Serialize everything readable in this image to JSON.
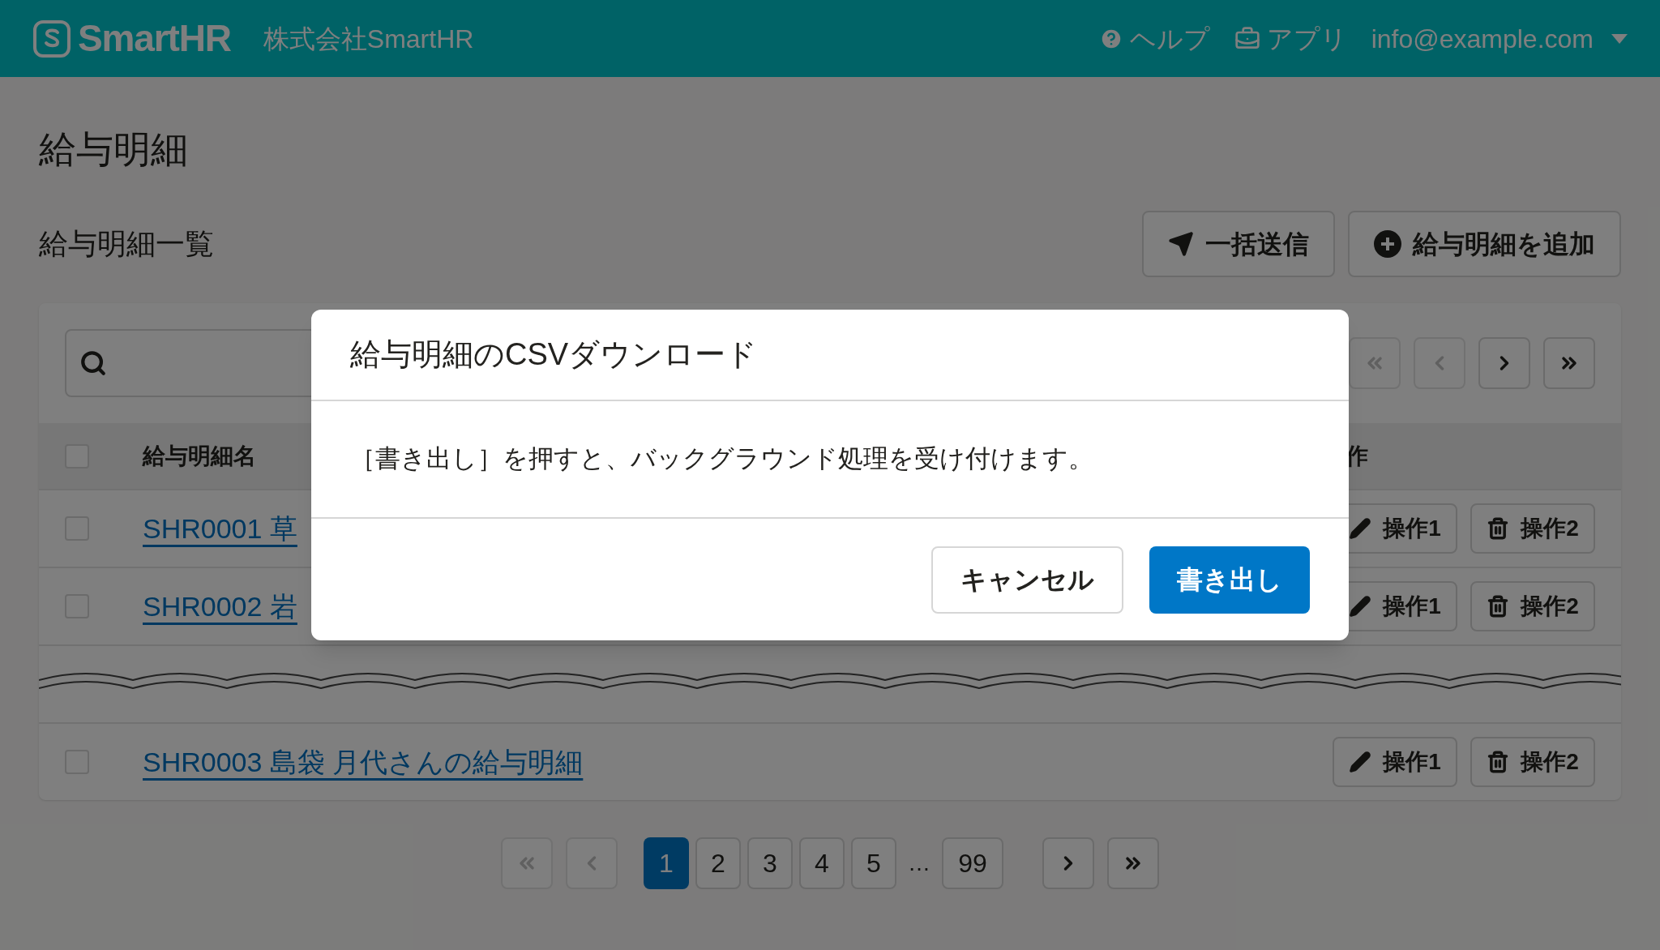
{
  "header": {
    "logo": "SmartHR",
    "company": "株式会社SmartHR",
    "nav": [
      {
        "kind": "help",
        "label": "ヘルプ"
      },
      {
        "kind": "apps",
        "label": "アプリ"
      }
    ],
    "user": "info@example.com"
  },
  "page_title": "給与明細",
  "section_title": "給与明細一覧",
  "actions": [
    {
      "kind": "send",
      "label": "一括送信"
    },
    {
      "kind": "add",
      "label": "給与明細を追加"
    }
  ],
  "table": {
    "top_pager": [
      {
        "kind": "first",
        "disabled": true
      },
      {
        "kind": "prev",
        "disabled": true
      },
      {
        "kind": "next",
        "disabled": false
      },
      {
        "kind": "last",
        "disabled": false
      }
    ],
    "columns": [
      "給与明細名",
      "作"
    ],
    "header_checked": false,
    "rows": [
      {
        "kind": "row",
        "name": "SHR0001 草",
        "checked": false,
        "actions": [
          "操作1",
          "操作2"
        ]
      },
      {
        "kind": "row",
        "name": "SHR0002 岩",
        "checked": false,
        "actions": [
          "操作1",
          "操作2"
        ]
      },
      {
        "kind": "break"
      },
      {
        "kind": "row",
        "name": "SHR0003 島袋 月代さんの給与明細",
        "checked": false,
        "actions": [
          "操作1",
          "操作2"
        ]
      }
    ]
  },
  "pagination": {
    "first_disabled": true,
    "prev_disabled": true,
    "pages": [
      {
        "label": "1",
        "selected": true
      },
      {
        "label": "2",
        "selected": false
      },
      {
        "label": "3",
        "selected": false
      },
      {
        "label": "4",
        "selected": false
      },
      {
        "label": "5",
        "selected": false
      }
    ],
    "ellipsis": "…",
    "last_page": "99",
    "next_disabled": false,
    "last_disabled": false
  },
  "modal": {
    "title": "給与明細のCSVダウンロード",
    "body": "［書き出し］を押すと、バックグラウンド処理を受け付けます。",
    "buttons": [
      {
        "kind": "secondary",
        "label": "キャンセル"
      },
      {
        "kind": "primary",
        "label": "書き出し"
      }
    ]
  }
}
